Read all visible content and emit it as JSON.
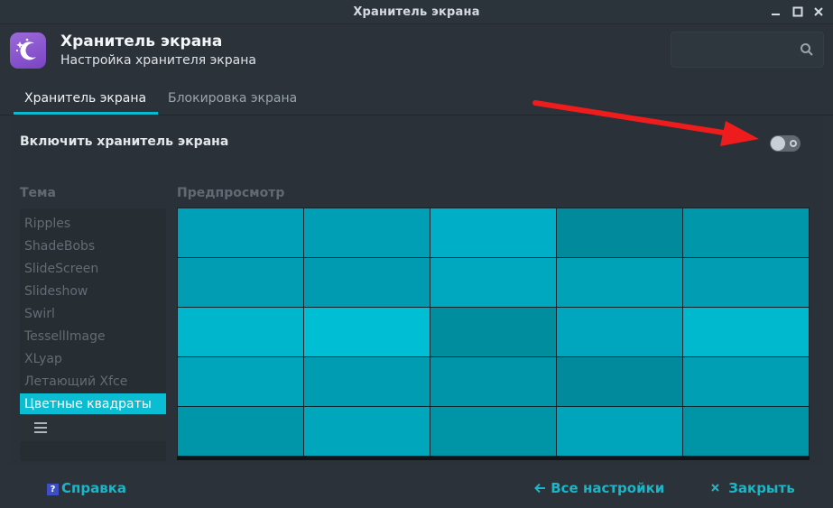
{
  "window": {
    "title": "Хранитель экрана",
    "controls": [
      "minimize-icon",
      "maximize-icon",
      "close-icon"
    ]
  },
  "header": {
    "app_icon": "moon-stars-icon",
    "title": "Хранитель экрана",
    "subtitle": "Настройка хранителя экрана",
    "search_icon": "search-icon"
  },
  "tabs": [
    {
      "label": "Хранитель экрана",
      "active": true
    },
    {
      "label": "Блокировка экрана",
      "active": false
    }
  ],
  "settings": {
    "enable_label": "Включить хранитель экрана",
    "enabled": false
  },
  "theme": {
    "heading": "Тема",
    "items": [
      "Ripples",
      "ShadeBobs",
      "SlideScreen",
      "Slideshow",
      "Swirl",
      "TessellImage",
      "XLyap",
      "Летающий Xfce",
      "Цветные квадраты"
    ],
    "selected_index": 8,
    "footer_icon": "menu-icon"
  },
  "preview": {
    "heading": "Предпросмотр",
    "grid_colors": [
      [
        "#00a1b8",
        "#009fb5",
        "#00afc7",
        "#008a9b",
        "#0097aa"
      ],
      [
        "#009db3",
        "#009bb0",
        "#00a8bf",
        "#00a2b8",
        "#009db3"
      ],
      [
        "#00b6cc",
        "#00bed4",
        "#008d9e",
        "#00a6bd",
        "#00b9cf"
      ],
      [
        "#00a5bc",
        "#009db2",
        "#0095a8",
        "#008a9c",
        "#009fb4"
      ],
      [
        "#0096a9",
        "#00a7bc",
        "#0094a7",
        "#00a5bb",
        "#0094a7"
      ]
    ]
  },
  "footer": {
    "help_label": "Справка",
    "help_icon": "help-icon",
    "all_settings_label": "Все настройки",
    "all_settings_icon": "arrow-left-icon",
    "close_label": "Закрыть",
    "close_icon": "close-icon"
  },
  "colors": {
    "accent": "#0bbdd2",
    "arrow": "#ee1c1c"
  }
}
